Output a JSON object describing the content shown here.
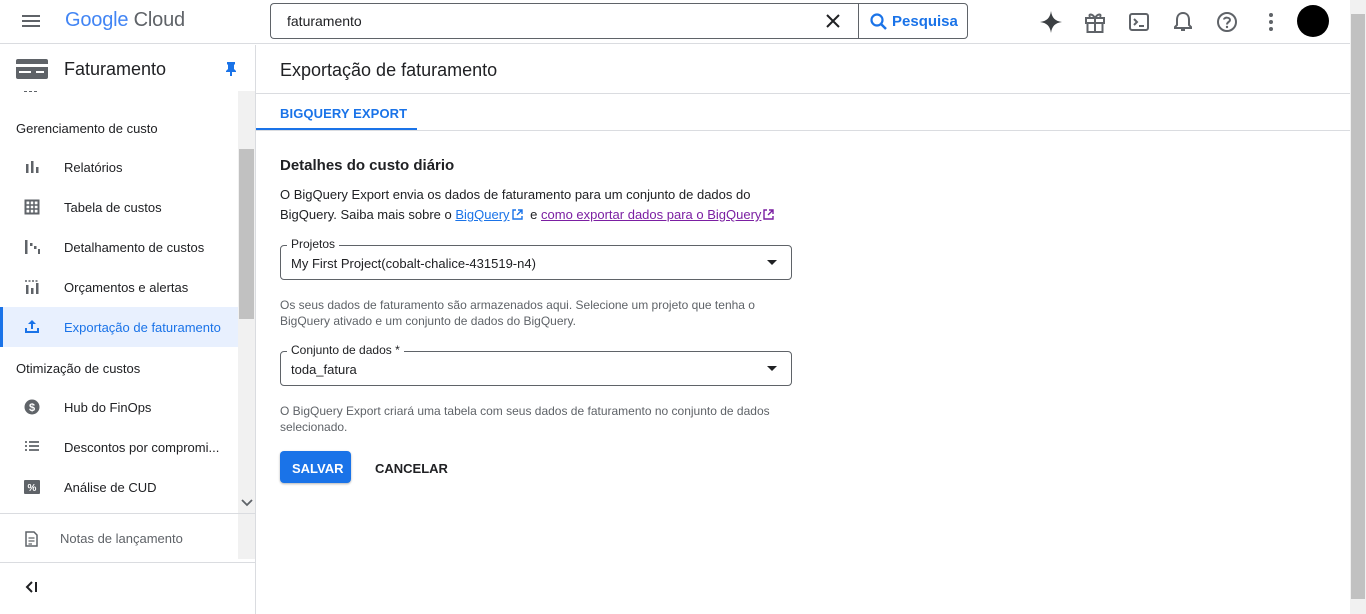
{
  "header": {
    "logo_google": "Google",
    "logo_cloud": "Cloud",
    "search_value": "faturamento",
    "search_button": "Pesquisa"
  },
  "sidebar": {
    "title": "Faturamento",
    "section_cost_management": "Gerenciamento de custo",
    "items": [
      {
        "label": "Relatórios",
        "icon": "bar-chart-icon"
      },
      {
        "label": "Tabela de custos",
        "icon": "table-icon"
      },
      {
        "label": "Detalhamento de custos",
        "icon": "breakdown-icon"
      },
      {
        "label": "Orçamentos e alertas",
        "icon": "budget-icon"
      },
      {
        "label": "Exportação de faturamento",
        "icon": "export-icon",
        "active": true
      }
    ],
    "section_optimization": "Otimização de custos",
    "items2": [
      {
        "label": "Hub do FinOps",
        "icon": "dollar-icon"
      },
      {
        "label": "Descontos por compromi...",
        "icon": "list-icon"
      },
      {
        "label": "Análise de CUD",
        "icon": "percent-icon"
      }
    ],
    "release_notes": "Notas de lançamento"
  },
  "main": {
    "page_title": "Exportação de faturamento",
    "tab": "BIGQUERY EXPORT",
    "section_title": "Detalhes do custo diário",
    "desc_prefix": "O BigQuery Export envia os dados de faturamento para um conjunto de dados do BigQuery. Saiba mais sobre o ",
    "desc_link1": "BigQuery",
    "desc_middle": " e ",
    "desc_link2": "como exportar dados para o BigQuery",
    "projects_label": "Projetos",
    "projects_value": "My First Project(cobalt-chalice-431519-n4)",
    "projects_hint": "Os seus dados de faturamento são armazenados aqui. Selecione um projeto que tenha o BigQuery ativado e um conjunto de dados do BigQuery.",
    "dataset_label": "Conjunto de dados *",
    "dataset_value": "toda_fatura",
    "dataset_hint": "O BigQuery Export criará uma tabela com seus dados de faturamento no conjunto de dados selecionado.",
    "save": "SALVAR",
    "cancel": "CANCELAR"
  },
  "colors": {
    "accent": "#1a73e8",
    "visited_link": "#7b1fa2",
    "active_bg": "#e8f0fe"
  }
}
